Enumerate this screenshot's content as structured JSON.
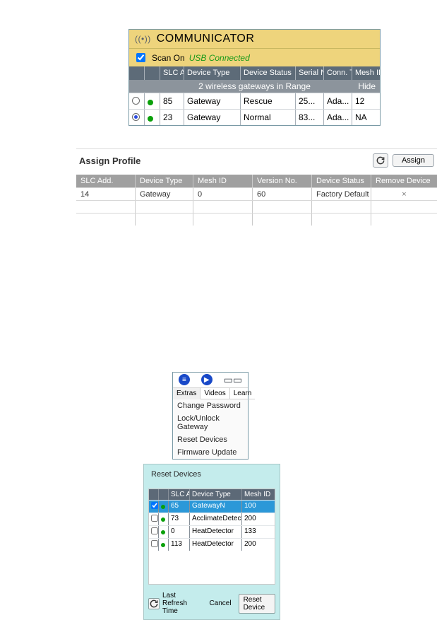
{
  "communicator": {
    "title": "COMMUNICATOR",
    "scan_label": "Scan On",
    "scan_checked": true,
    "usb_status": "USB Connected",
    "columns": {
      "slc": "SLC Add.",
      "dtype": "Device Type",
      "dstat": "Device Status",
      "ser": "Serial No.",
      "conn": "Conn. Type",
      "mesh": "Mesh ID"
    },
    "range_text": "2 wireless gateways in Range",
    "hide_label": "Hide",
    "rows": [
      {
        "selected": false,
        "online": true,
        "slc": "85",
        "dtype": "Gateway",
        "dstat": "Rescue",
        "ser": "25...",
        "conn": "Ada...",
        "mesh": "12"
      },
      {
        "selected": true,
        "online": true,
        "slc": "23",
        "dtype": "Gateway",
        "dstat": "Normal",
        "ser": "83...",
        "conn": "Ada...",
        "mesh": "NA"
      }
    ]
  },
  "assign": {
    "title": "Assign Profile",
    "assign_label": "Assign",
    "columns": {
      "slc": "SLC Add.",
      "dtype": "Device Type",
      "mesh": "Mesh ID",
      "ver": "Version No.",
      "stat": "Device Status",
      "rem": "Remove Device"
    },
    "rows": [
      {
        "slc": "14",
        "dtype": "Gateway",
        "mesh": "0",
        "ver": "60",
        "stat": "Factory Default",
        "remove": "×"
      },
      {
        "slc": "",
        "dtype": "",
        "mesh": "",
        "ver": "",
        "stat": "",
        "remove": ""
      },
      {
        "slc": "",
        "dtype": "",
        "mesh": "",
        "ver": "",
        "stat": "",
        "remove": ""
      }
    ]
  },
  "extras": {
    "tabs": [
      "Extras",
      "Videos",
      "Learn"
    ],
    "items": [
      "Change Password",
      "Lock/Unlock Gateway",
      "Reset Devices",
      "Firmware Update"
    ]
  },
  "reset": {
    "title": "Reset Devices",
    "columns": {
      "slc": "SLC Add.",
      "dtype": "Device Type",
      "mesh": "Mesh ID"
    },
    "rows": [
      {
        "checked": true,
        "online": true,
        "slc": "65",
        "dtype": "GatewayN",
        "mesh": "100",
        "selected": true
      },
      {
        "checked": false,
        "online": true,
        "slc": "73",
        "dtype": "AcclimateDetector",
        "mesh": "200",
        "selected": false
      },
      {
        "checked": false,
        "online": true,
        "slc": "0",
        "dtype": "HeatDetector",
        "mesh": "133",
        "selected": false
      },
      {
        "checked": false,
        "online": true,
        "slc": "113",
        "dtype": "HeatDetector",
        "mesh": "200",
        "selected": false
      }
    ],
    "refresh_label": "Last Refresh Time",
    "cancel_label": "Cancel",
    "reset_label": "Reset Device"
  }
}
